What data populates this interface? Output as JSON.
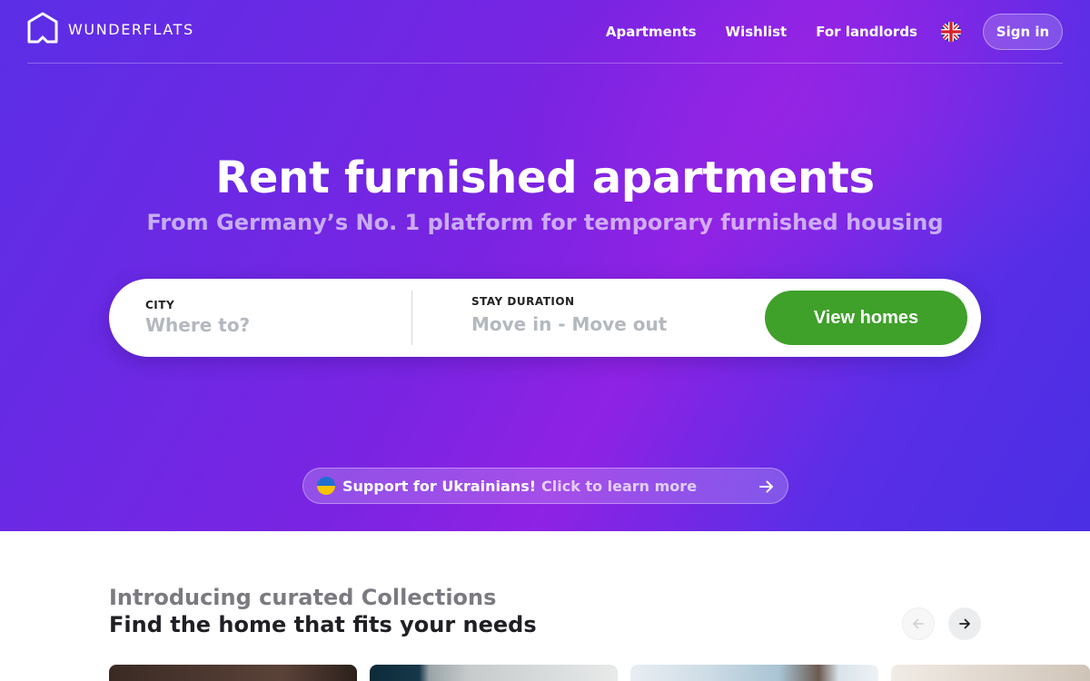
{
  "header": {
    "brand": "WUNDERFLATS",
    "nav": [
      {
        "label": "Apartments"
      },
      {
        "label": "Wishlist"
      },
      {
        "label": "For landlords"
      }
    ],
    "language_icon": "uk-flag-icon",
    "sign_in_label": "Sign in"
  },
  "hero": {
    "title": "Rent furnished apartments",
    "subtitle": "From Germany’s No. 1 platform for temporary furnished housing"
  },
  "search": {
    "city_label": "CITY",
    "city_placeholder": "Where to?",
    "city_value": "",
    "stay_label": "STAY DURATION",
    "stay_placeholder": "Move in - Move out",
    "submit_label": "View homes"
  },
  "ukraine_banner": {
    "icon": "ukraine-flag-icon",
    "strong_text": "Support for Ukrainians!",
    "link_text": "Click to learn more"
  },
  "collections": {
    "intro": "Introducing curated Collections",
    "title": "Find the home that fits your needs"
  },
  "colors": {
    "hero_gradient_start": "#5b2ee6",
    "hero_gradient_mid": "#8f22e4",
    "primary_button": "#3fa02a",
    "heading_text": "#1f1f24",
    "muted_text": "#7a7a80"
  }
}
